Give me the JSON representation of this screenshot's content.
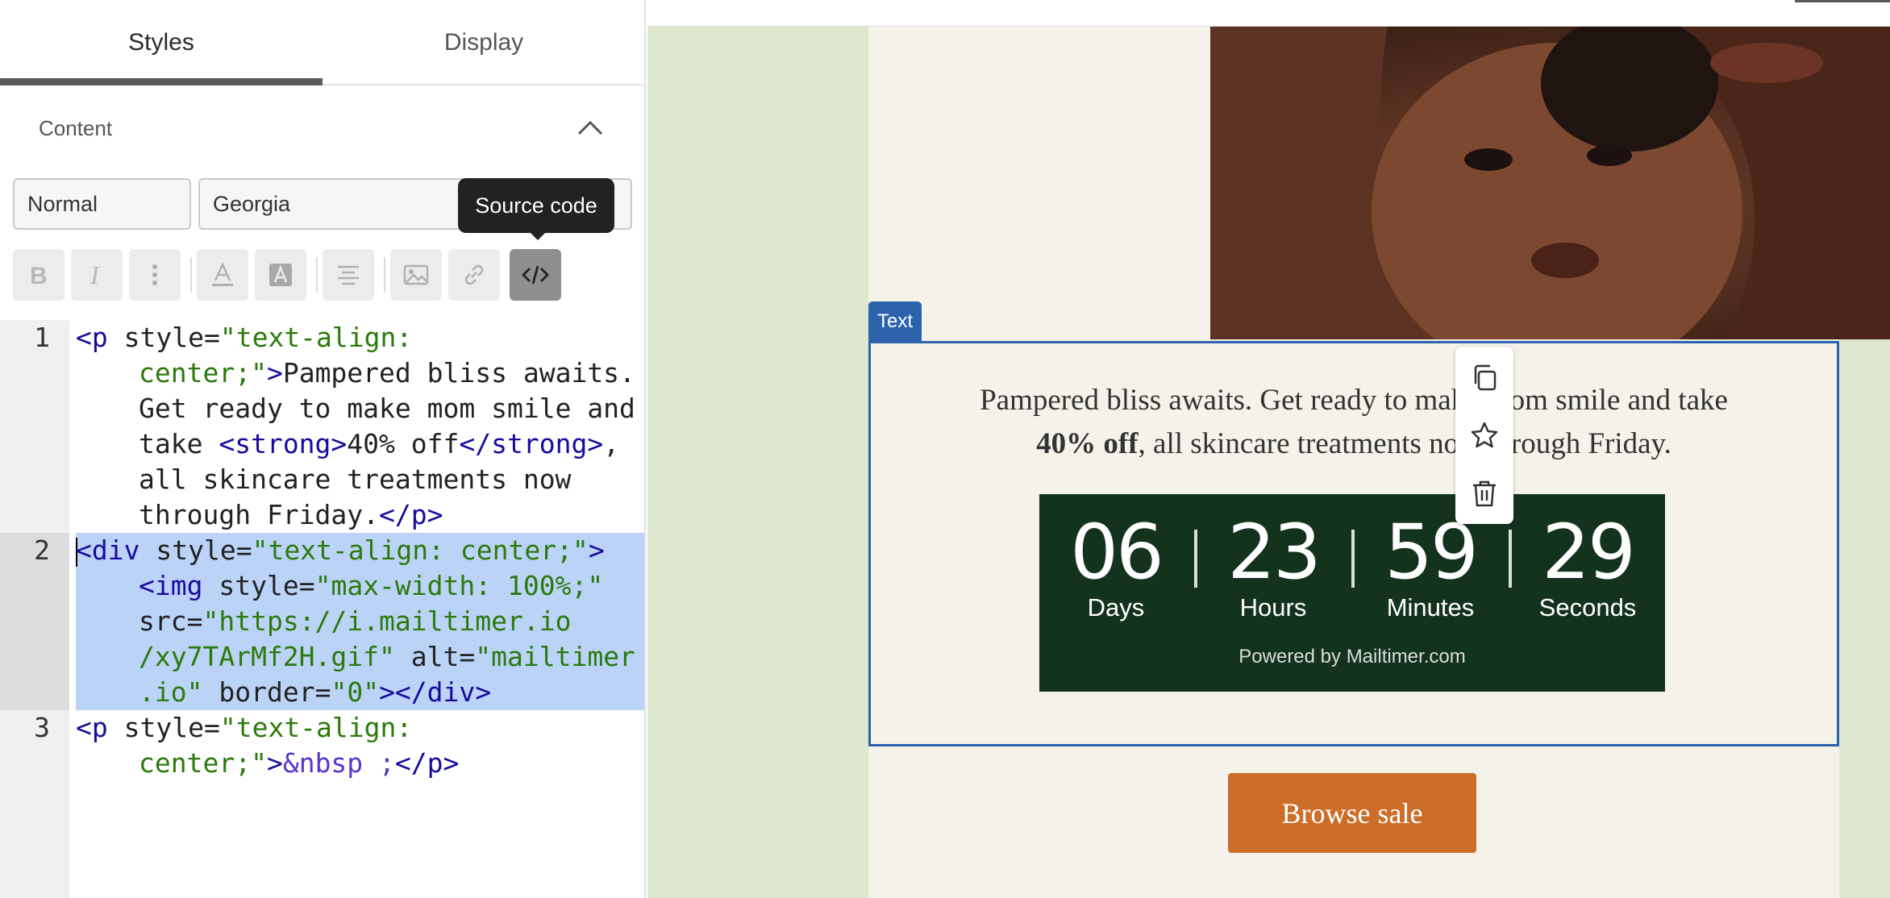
{
  "tabs": {
    "styles": "Styles",
    "display": "Display"
  },
  "content_section": {
    "title": "Content"
  },
  "selects": {
    "style": "Normal",
    "font": "Georgia"
  },
  "tooltip": "Source code",
  "toolbar": {
    "buttons": [
      "bold-icon",
      "italic-icon",
      "more-icon",
      "text-color-icon",
      "highlight-color-icon",
      "align-center-icon",
      "image-icon",
      "link-icon",
      "source-code-icon"
    ],
    "active": "source-code-icon"
  },
  "editor": {
    "line_numbers": [
      "1",
      "2",
      "3"
    ],
    "line1": {
      "p_open": "<p",
      "style_attr": "style",
      "style_val": "\"text-align: center;\"",
      "gt": ">",
      "text_a": "Pampered bliss awaits. Get ready to make mom smile and take ",
      "strong_open": "<strong>",
      "strong_text": "40% off",
      "strong_close": "</strong>",
      "text_b": ", all skincare treatments now through Friday.",
      "p_close": "</p>"
    },
    "line2": {
      "div_open": "div",
      "style_attr": "style",
      "style_val": "\"text-align: center;\"",
      "img_open": "><img",
      "img_style_attr": "style",
      "img_style_val": "\"max-width: 100%;\"",
      "src_attr": "src",
      "src_val": "\"https://i.mailtimer.io /xy7TArMf2H.gif\"",
      "alt_attr": "alt",
      "alt_val": "\"mailtimer .io\"",
      "border_attr": "border",
      "border_val": "\"0\"",
      "close": "></div>"
    },
    "line3": {
      "p_open": "<p",
      "style_attr": "style",
      "style_val": "\"text-align: center;\"",
      "gt": ">",
      "entity": "&nbsp ;",
      "p_close": "</p>"
    }
  },
  "canvas": {
    "block_badge": "Text",
    "copy_a": "Pampered bliss awaits. Get ready to make mom smile and take",
    "copy_bold": "40% off",
    "copy_b": ", all skincare treatments now through Friday.",
    "countdown": {
      "days": "06",
      "days_label": "Days",
      "hours": "23",
      "hours_label": "Hours",
      "minutes": "59",
      "minutes_label": "Minutes",
      "seconds": "29",
      "seconds_label": "Seconds",
      "powered_by": "Powered by Mailtimer.com"
    },
    "side_tools": [
      "copy-icon",
      "star-icon",
      "trash-icon"
    ],
    "cta": "Browse sale",
    "colors": {
      "canvas_bg": "#dde8cf",
      "email_bg": "#f5f2ea",
      "selection_blue": "#2d62ac",
      "countdown_bg": "#13331f",
      "cta_bg": "#cc6e2a"
    }
  }
}
